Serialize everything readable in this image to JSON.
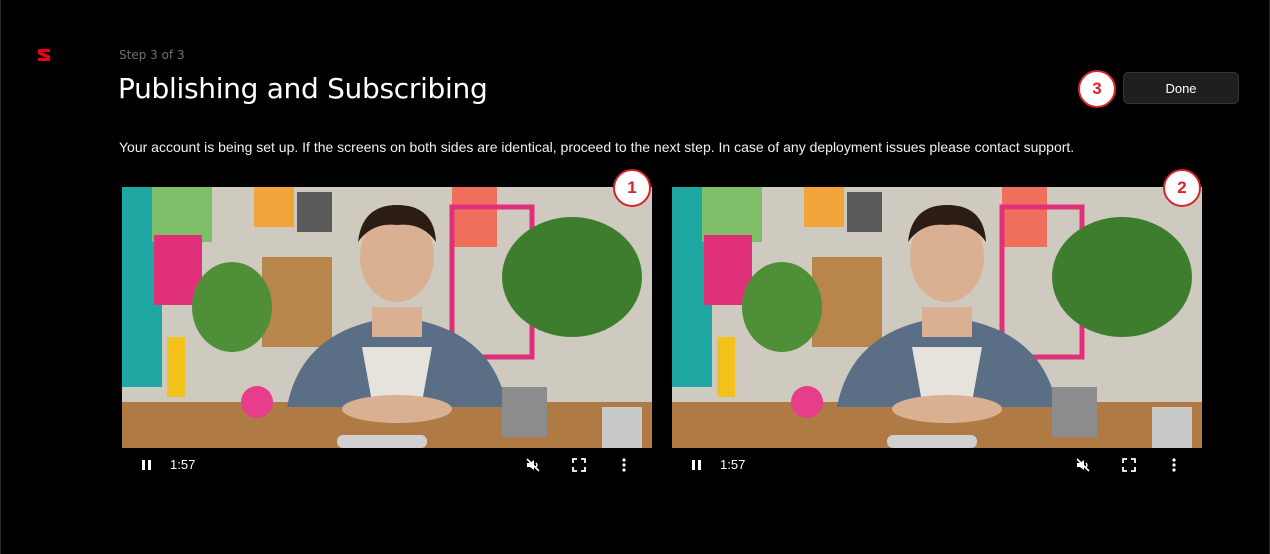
{
  "header": {
    "step_label": "Step 3 of 3",
    "title": "Publishing and Subscribing",
    "done_label": "Done",
    "description": "Your account is being set up. If the screens on both sides are identical, proceed to the next step. In case of any deployment issues please contact support."
  },
  "badges": {
    "first": "1",
    "second": "2",
    "third": "3"
  },
  "players": [
    {
      "time": "1:57",
      "muted": true,
      "state": "playing"
    },
    {
      "time": "1:57",
      "muted": true,
      "state": "playing"
    }
  ],
  "icons": {
    "logo": "brand-logo-icon",
    "pause": "pause-icon",
    "mute": "volume-muted-icon",
    "fullscreen": "fullscreen-icon",
    "more": "more-vertical-icon"
  },
  "colors": {
    "accent": "#d8232a",
    "background": "#000000",
    "button": "#1f1f1f"
  }
}
